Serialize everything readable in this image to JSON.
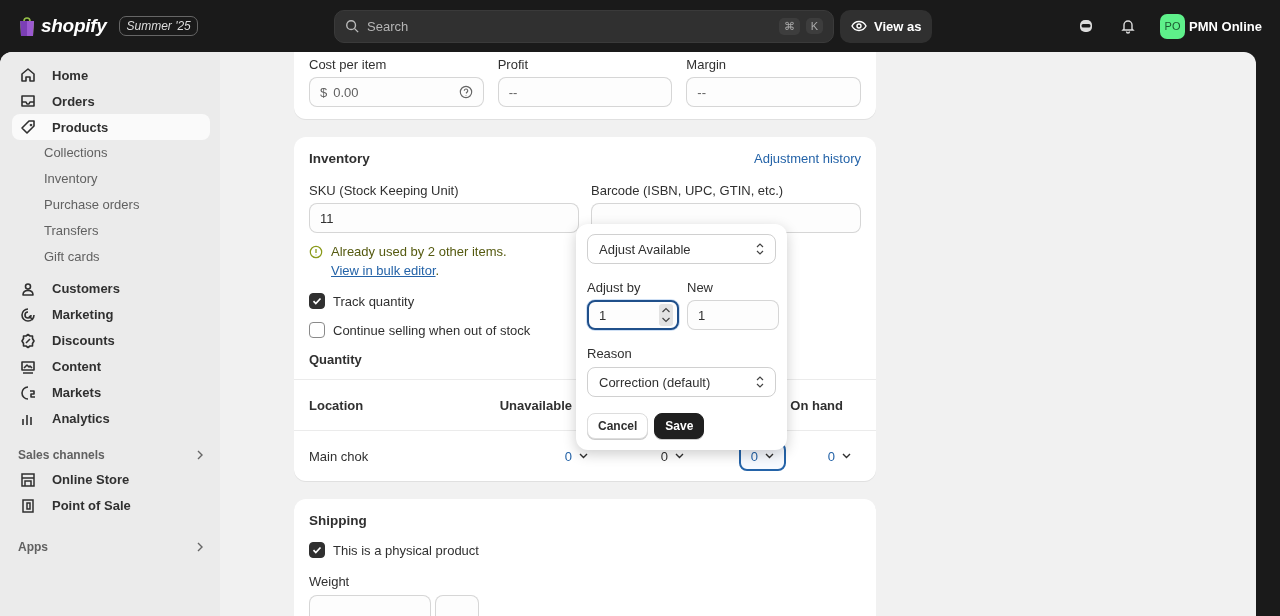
{
  "topbar": {
    "logo": "shopify",
    "edition_badge": "Summer '25",
    "search": {
      "placeholder": "Search"
    },
    "shortcut_keys": [
      "⌘",
      "K"
    ],
    "view_as_button": "View as",
    "avatar_initials": "PO",
    "store_name": "PMN Online"
  },
  "sidebar": {
    "items": [
      {
        "label": "Home",
        "selected": false
      },
      {
        "label": "Orders",
        "selected": false
      },
      {
        "label": "Products",
        "selected": true,
        "children": [
          {
            "label": "Collections",
            "selected": false
          },
          {
            "label": "Inventory",
            "selected": false
          },
          {
            "label": "Purchase orders",
            "selected": false
          },
          {
            "label": "Transfers",
            "selected": false
          },
          {
            "label": "Gift cards",
            "selected": false
          }
        ]
      },
      {
        "label": "Customers",
        "selected": false
      },
      {
        "label": "Marketing",
        "selected": false
      },
      {
        "label": "Discounts",
        "selected": false
      },
      {
        "label": "Content",
        "selected": false
      },
      {
        "label": "Markets",
        "selected": false
      },
      {
        "label": "Analytics",
        "selected": false
      }
    ],
    "sales_channels": {
      "title": "Sales channels",
      "items": [
        {
          "label": "Online Store",
          "selected": false
        },
        {
          "label": "Point of Sale",
          "selected": false
        }
      ]
    },
    "apps": {
      "title": "Apps"
    }
  },
  "pricing": {
    "fields": [
      {
        "label": "Cost per item",
        "prefix": "$",
        "value": "0.00",
        "help": true
      },
      {
        "label": "Profit",
        "value": "--",
        "help": false
      },
      {
        "label": "Margin",
        "value": "--",
        "help": false
      }
    ]
  },
  "inventory": {
    "title": "Inventory",
    "history_link": "Adjustment history",
    "sku": {
      "label": "SKU (Stock Keeping Unit)",
      "value": "11"
    },
    "barcode": {
      "label": "Barcode (ISBN, UPC, GTIN, etc.)"
    },
    "warning": {
      "text": "Already used by 2 other items.",
      "link": "View in bulk editor",
      "end": "."
    },
    "checkboxes": [
      {
        "label": "Track quantity",
        "checked": true
      },
      {
        "label": "Continue selling when out of stock",
        "checked": false
      }
    ],
    "quantity": {
      "title": "Quantity",
      "columns": [
        {
          "label": "Location"
        },
        {
          "label": "Unavailable"
        },
        {},
        {},
        {
          "label": "On hand"
        }
      ],
      "rows": [
        {
          "cells": [
            {
              "value": "Main chok",
              "kind": "location"
            },
            {
              "value": "0",
              "kind": "link",
              "focused": false
            },
            {
              "value": "0",
              "kind": "plain",
              "focused": false
            },
            {
              "value": "0",
              "kind": "link",
              "focused": true
            },
            {
              "value": "0",
              "kind": "link",
              "focused": false
            }
          ]
        }
      ]
    }
  },
  "adjust_popover": {
    "adjust_type": "Adjust Available",
    "adjust_by": {
      "label": "Adjust by",
      "value": "1"
    },
    "new": {
      "label": "New",
      "value": "1"
    },
    "reason": {
      "label": "Reason",
      "value": "Correction (default)"
    },
    "buttons": [
      {
        "label": "Cancel",
        "kind": "secondary"
      },
      {
        "label": "Save",
        "kind": "primary"
      }
    ]
  },
  "shipping": {
    "title": "Shipping",
    "checkboxes": [
      {
        "label": "This is a physical product",
        "checked": true
      }
    ],
    "weight": {
      "label": "Weight"
    }
  }
}
